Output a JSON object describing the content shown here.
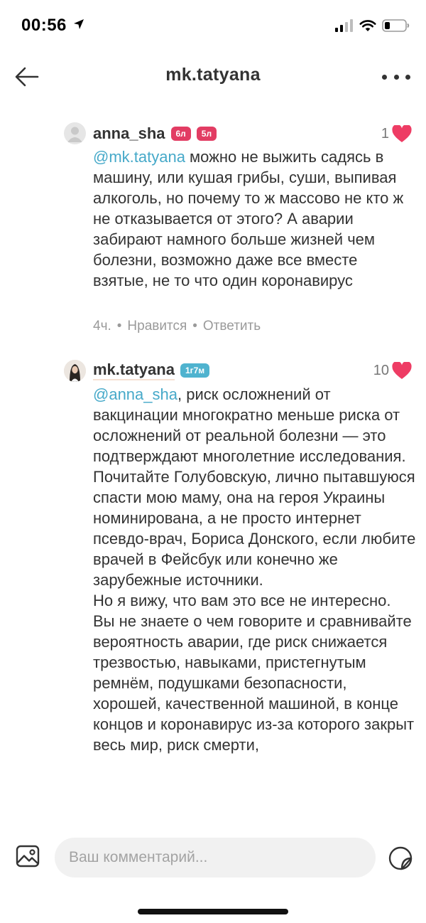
{
  "status_bar": {
    "time": "00:56"
  },
  "header": {
    "title": "mk.tatyana"
  },
  "comments": [
    {
      "username": "anna_sha",
      "badges": [
        "6л",
        "5л"
      ],
      "likes": "1",
      "mention": "@mk.tatyana",
      "text": " можно не выжить садясь в машину,  или кушая грибы, суши, выпивая алкоголь,  но почему то ж массово не кто ж не отказывается от этого? А аварии забирают намного больше жизней чем болезни, возможно даже все вместе взятые,  не то что один коронавирус",
      "time": "4ч.",
      "like_action": "Нравится",
      "reply_action": "Ответить"
    },
    {
      "username": "mk.tatyana",
      "badges": [
        "1г7м"
      ],
      "likes": "10",
      "mention": "@anna_sha",
      "text": ", риск осложнений от вакцинации многократно меньше риска от осложнений от реальной болезни — это подтверждают многолетние исследования.\nПочитайте Голубовскую, лично пытавшуюся спасти мою маму, она на героя Украины номинирована, а не просто интернет псевдо-врач, Бориса Донского, если любите врачей в Фейсбук или конечно же зарубежные источники.\nНо я вижу, что вам это все не интересно.\nВы не знаете о чем говорите и сравнивайте вероятность аварии, где риск снижается трезвостью, навыками, пристегнутым ремнём, подушками безопасности, хорошей, качественной машиной, в конце концов и коронавирус из-за которого закрыт весь мир, риск смерти,"
    }
  ],
  "input": {
    "placeholder": "Ваш комментарий..."
  },
  "colors": {
    "mention": "#46a9c9",
    "heart": "#ee3c64",
    "badge_red": "#e23c63",
    "badge_blue": "#4fb3cf"
  },
  "icons": [
    "location-arrow-icon",
    "signal-icon",
    "wifi-icon",
    "battery-icon",
    "back-arrow-icon",
    "more-dots-icon",
    "heart-icon",
    "gallery-icon",
    "sticker-icon"
  ]
}
